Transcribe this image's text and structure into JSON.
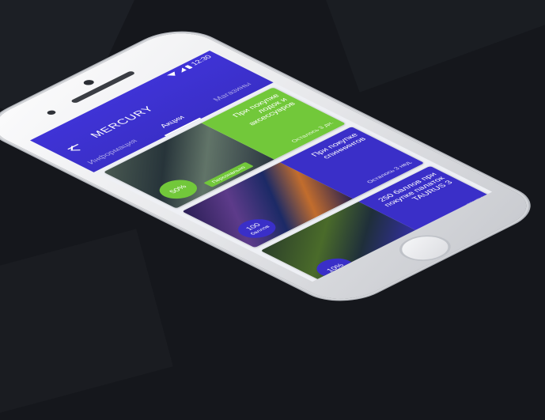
{
  "status_bar": {
    "time": "12:30"
  },
  "app": {
    "title": "MERCURY"
  },
  "tabs": [
    {
      "label": "Информация",
      "active": false
    },
    {
      "label": "Акции",
      "active": true
    },
    {
      "label": "Магазины",
      "active": false
    }
  ],
  "cards": [
    {
      "title": "При покупке лодок и аксессуаров",
      "meta": "Осталось 3 дн.",
      "badge": "50%",
      "badge_sub": "",
      "tag": "Персонально",
      "small": ""
    },
    {
      "title": "При покупке спиннингов",
      "meta": "Осталось 3 нед.",
      "badge": "100",
      "badge_sub": "баллов",
      "tag": "",
      "small": ""
    },
    {
      "title": "250 баллов при покупке палаток TAURUS 3",
      "meta": "Осталось 2 мес.",
      "badge": "10%",
      "badge_sub": "",
      "tag": "",
      "small": "ТЕНТЫ",
      "img_label": "TAURUS 3"
    }
  ],
  "colors": {
    "primary": "#3a2fc8",
    "accent": "#72c83a",
    "background": "#15171c"
  }
}
